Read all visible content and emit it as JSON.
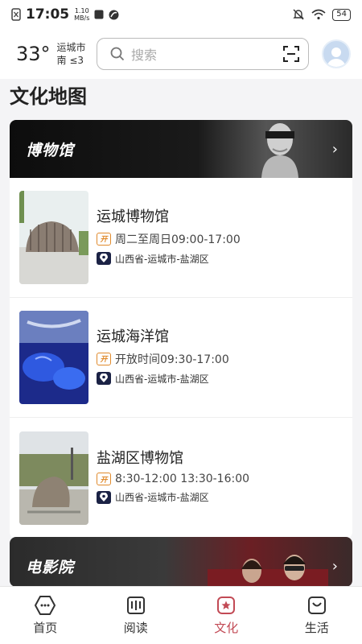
{
  "status_bar": {
    "time": "17:05",
    "speed_value": "1.10",
    "speed_unit": "MB/s",
    "battery": "54"
  },
  "header": {
    "temperature": "33°",
    "city": "运城市",
    "wind": "南 ≤3",
    "search_placeholder": "搜索"
  },
  "page_title": "文化地图",
  "museum_section": {
    "title": "博物馆",
    "venues": [
      {
        "name": "运城博物馆",
        "hours": "周二至周日09:00-17:00",
        "address": "山西省-运城市-盐湖区",
        "open_badge": "开"
      },
      {
        "name": "运城海洋馆",
        "hours": "开放时间09:30-17:00",
        "address": "山西省-运城市-盐湖区",
        "open_badge": "开"
      },
      {
        "name": "盐湖区博物馆",
        "hours": "8:30-12:00 13:30-16:00",
        "address": "山西省-运城市-盐湖区",
        "open_badge": "开"
      }
    ]
  },
  "cinema_section": {
    "title": "电影院"
  },
  "bottom_nav": [
    {
      "label": "首页",
      "icon": "home-icon"
    },
    {
      "label": "阅读",
      "icon": "book-icon"
    },
    {
      "label": "文化",
      "icon": "culture-star-icon"
    },
    {
      "label": "生活",
      "icon": "life-bag-icon"
    }
  ],
  "colors": {
    "accent": "#c24a55",
    "open_badge": "#e08a2c",
    "pin_badge": "#1b2245"
  }
}
